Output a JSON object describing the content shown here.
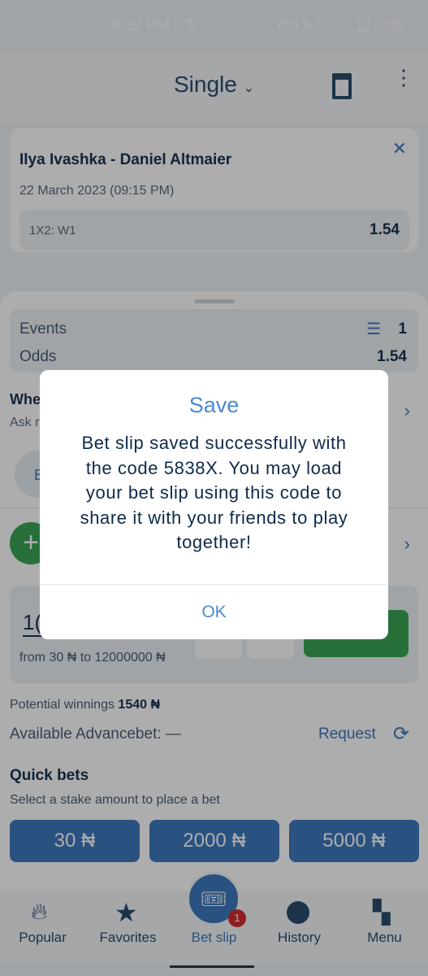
{
  "status_bar": {
    "time": "9:22 PM",
    "network": "4G",
    "speed": "671 K/s",
    "battery": "100"
  },
  "header": {
    "title": "Single"
  },
  "event": {
    "title": "Ilya Ivashka - Daniel Altmaier",
    "date": "22 March 2023 (09:15 PM)",
    "market": "1X2: W1",
    "odds": "1.54"
  },
  "summary": {
    "events_label": "Events",
    "events_value": "1",
    "odds_label": "Odds",
    "odds_value": "1.54"
  },
  "promo": {
    "title": "Whe",
    "subtitle": "Ask r",
    "chip": "E"
  },
  "stake": {
    "value": "1(",
    "range": "from 30 ₦ to 12000000 ₦"
  },
  "potential": {
    "label": "Potential winnings",
    "value": "1540 ₦"
  },
  "advancebet": {
    "label": "Available Advancebet: —",
    "request": "Request"
  },
  "quick_bets": {
    "title": "Quick bets",
    "subtitle": "Select a stake amount to place a bet",
    "amounts": [
      "30 ₦",
      "2000 ₦",
      "5000 ₦"
    ]
  },
  "nav": {
    "items": [
      "Popular",
      "Favorites",
      "Bet slip",
      "History",
      "Menu"
    ],
    "badge": "1"
  },
  "dialog": {
    "title": "Save",
    "message": "Bet slip saved successfully with the code 5838X. You may load your bet slip using this code to share it with your friends to play together!",
    "ok": "OK"
  },
  "colors": {
    "accent": "#3e79bd",
    "green": "#3aa655",
    "badge": "#d32f2f"
  }
}
